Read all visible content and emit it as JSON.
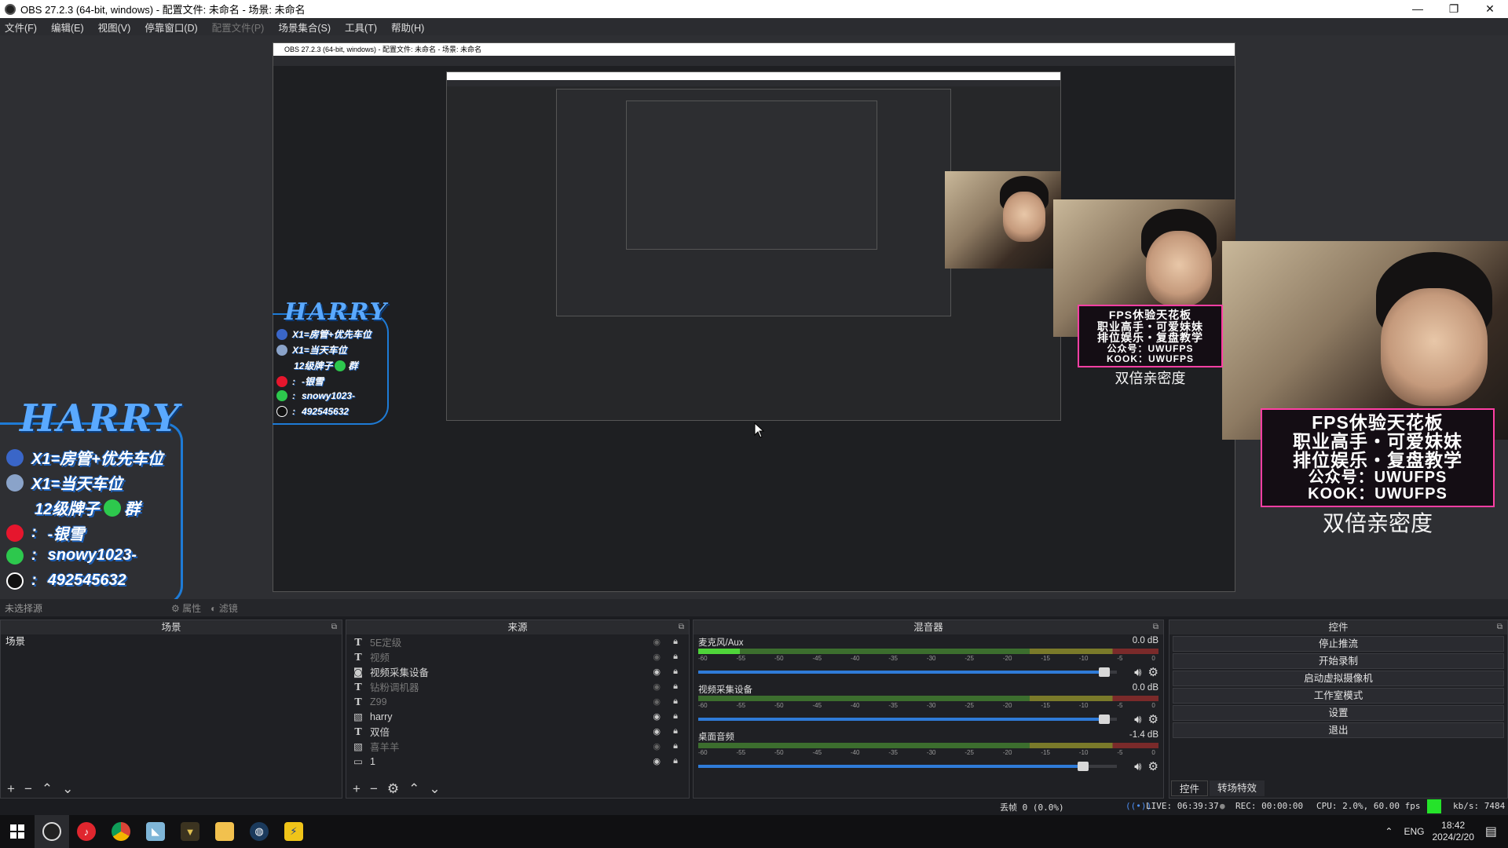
{
  "window": {
    "title": "OBS 27.2.3 (64-bit, windows) - 配置文件: 未命名 - 场景: 未命名",
    "min": "—",
    "max": "❐",
    "close": "✕"
  },
  "menu": [
    "文件(F)",
    "编辑(E)",
    "视图(V)",
    "停靠窗口(D)",
    "配置文件(P)",
    "场景集合(S)",
    "工具(T)",
    "帮助(H)"
  ],
  "preview": {
    "overlay": {
      "logo": "HARRY",
      "lines": [
        "X1=房管+优先车位",
        "X1=当天车位",
        "12级牌子",
        "群",
        "-银雪",
        "snowy1023-",
        "492545632"
      ],
      "line_prefix": ":"
    },
    "promo": [
      "FPS休验天花板",
      "职业高手・可爱妹妹",
      "排位娱乐・复盘教学",
      "公众号：UWUFPS",
      "KOOK：UWUFPS"
    ],
    "caption": "双倍亲密度"
  },
  "source_toolbar": {
    "no_source": "未选择源",
    "properties": "属性",
    "filters": "滤镜"
  },
  "scenes": {
    "title": "场景",
    "items": [
      "场景"
    ]
  },
  "sources": {
    "title": "来源",
    "items": [
      {
        "type": "T",
        "name": "5E定级",
        "visible": false
      },
      {
        "type": "T",
        "name": "视频",
        "visible": false
      },
      {
        "type": "◙",
        "name": "视频采集设备",
        "visible": true
      },
      {
        "type": "T",
        "name": "钻粉调机器",
        "visible": false
      },
      {
        "type": "T",
        "name": "Z99",
        "visible": false
      },
      {
        "type": "▧",
        "name": "harry",
        "visible": true
      },
      {
        "type": "T",
        "name": "双倍",
        "visible": true
      },
      {
        "type": "▧",
        "name": "喜羊羊",
        "visible": false
      },
      {
        "type": "▭",
        "name": "1",
        "visible": true
      }
    ]
  },
  "mixer": {
    "title": "混音器",
    "ticks": [
      "-60",
      "-55",
      "-50",
      "-45",
      "-40",
      "-35",
      "-30",
      "-25",
      "-20",
      "-15",
      "-10",
      "-5",
      "0"
    ],
    "channels": [
      {
        "name": "麦克风/Aux",
        "db": "0.0 dB",
        "meter": 0.09,
        "volume": 0.97
      },
      {
        "name": "视频采集设备",
        "db": "0.0 dB",
        "meter": 0.0,
        "volume": 0.97
      },
      {
        "name": "桌面音频",
        "db": "-1.4 dB",
        "meter": 0.0,
        "volume": 0.92
      }
    ]
  },
  "controls": {
    "title": "控件",
    "buttons": [
      "停止推流",
      "开始录制",
      "启动虚拟摄像机",
      "工作室模式",
      "设置",
      "退出"
    ],
    "tabs": [
      "控件",
      "转场特效"
    ]
  },
  "status": {
    "dropped": "丢帧 0 (0.0%)",
    "live": "LIVE: 06:39:37",
    "rec": "REC: 00:00:00",
    "cpu": "CPU: 2.0%, 60.00 fps",
    "kbps": "kb/s: 7484",
    "indicator_color": "#25e32a"
  },
  "taskbar": {
    "ime": "ENG",
    "time": "18:42",
    "date": "2024/2/20"
  }
}
